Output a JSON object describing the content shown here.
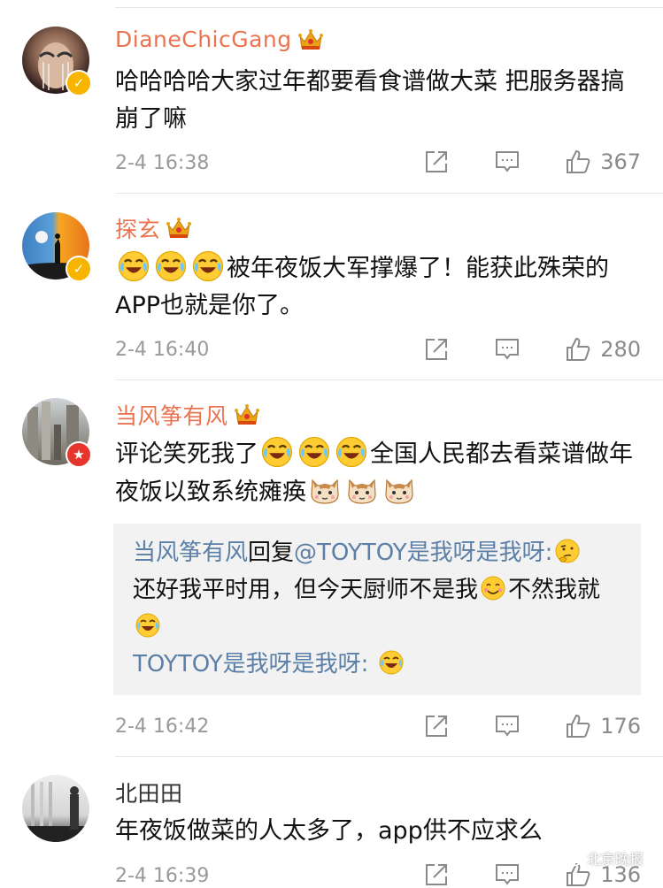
{
  "comments": [
    {
      "username": "DianeChicGang",
      "text": "哈哈哈哈大家过年都要看食谱做大菜 把服务器搞崩了嘛",
      "time": "2-4 16:38",
      "likes": "367"
    },
    {
      "username": "探玄",
      "text": "被年夜饭大军撑爆了！能获此殊荣的APP也就是你了。",
      "time": "2-4 16:40",
      "likes": "280"
    },
    {
      "username": "当风筝有风",
      "text_part1": "评论笑死我了",
      "text_part2": "全国人民都去看菜谱做年夜饭以致系统瘫痪",
      "time": "2-4 16:42",
      "likes": "176",
      "reply": {
        "author": "当风筝有风",
        "verb": "回复",
        "target": "@TOYTOY是我呀是我呀:",
        "body_part1": "还好我平时用，但今天厨师不是我",
        "body_part2": "不然我就",
        "quoted_author": "TOYTOY是我呀是我呀:"
      }
    },
    {
      "username": "北田田",
      "text": "年夜饭做菜的人太多了，app供不应求么",
      "time": "2-4 16:39",
      "likes": "136"
    }
  ],
  "watermark": "北京晚报",
  "colors": {
    "username": "#eb7350",
    "link_blue": "#5b7fa6",
    "meta_gray": "#9a9a9a",
    "reply_bg": "#f2f2f2"
  },
  "icons": [
    "crown-icon",
    "verified-badge-icon",
    "share-icon",
    "reply-icon",
    "like-icon",
    "laugh-cry-emoji",
    "cat-emoji",
    "thinking-emoji",
    "smile-emoji"
  ]
}
